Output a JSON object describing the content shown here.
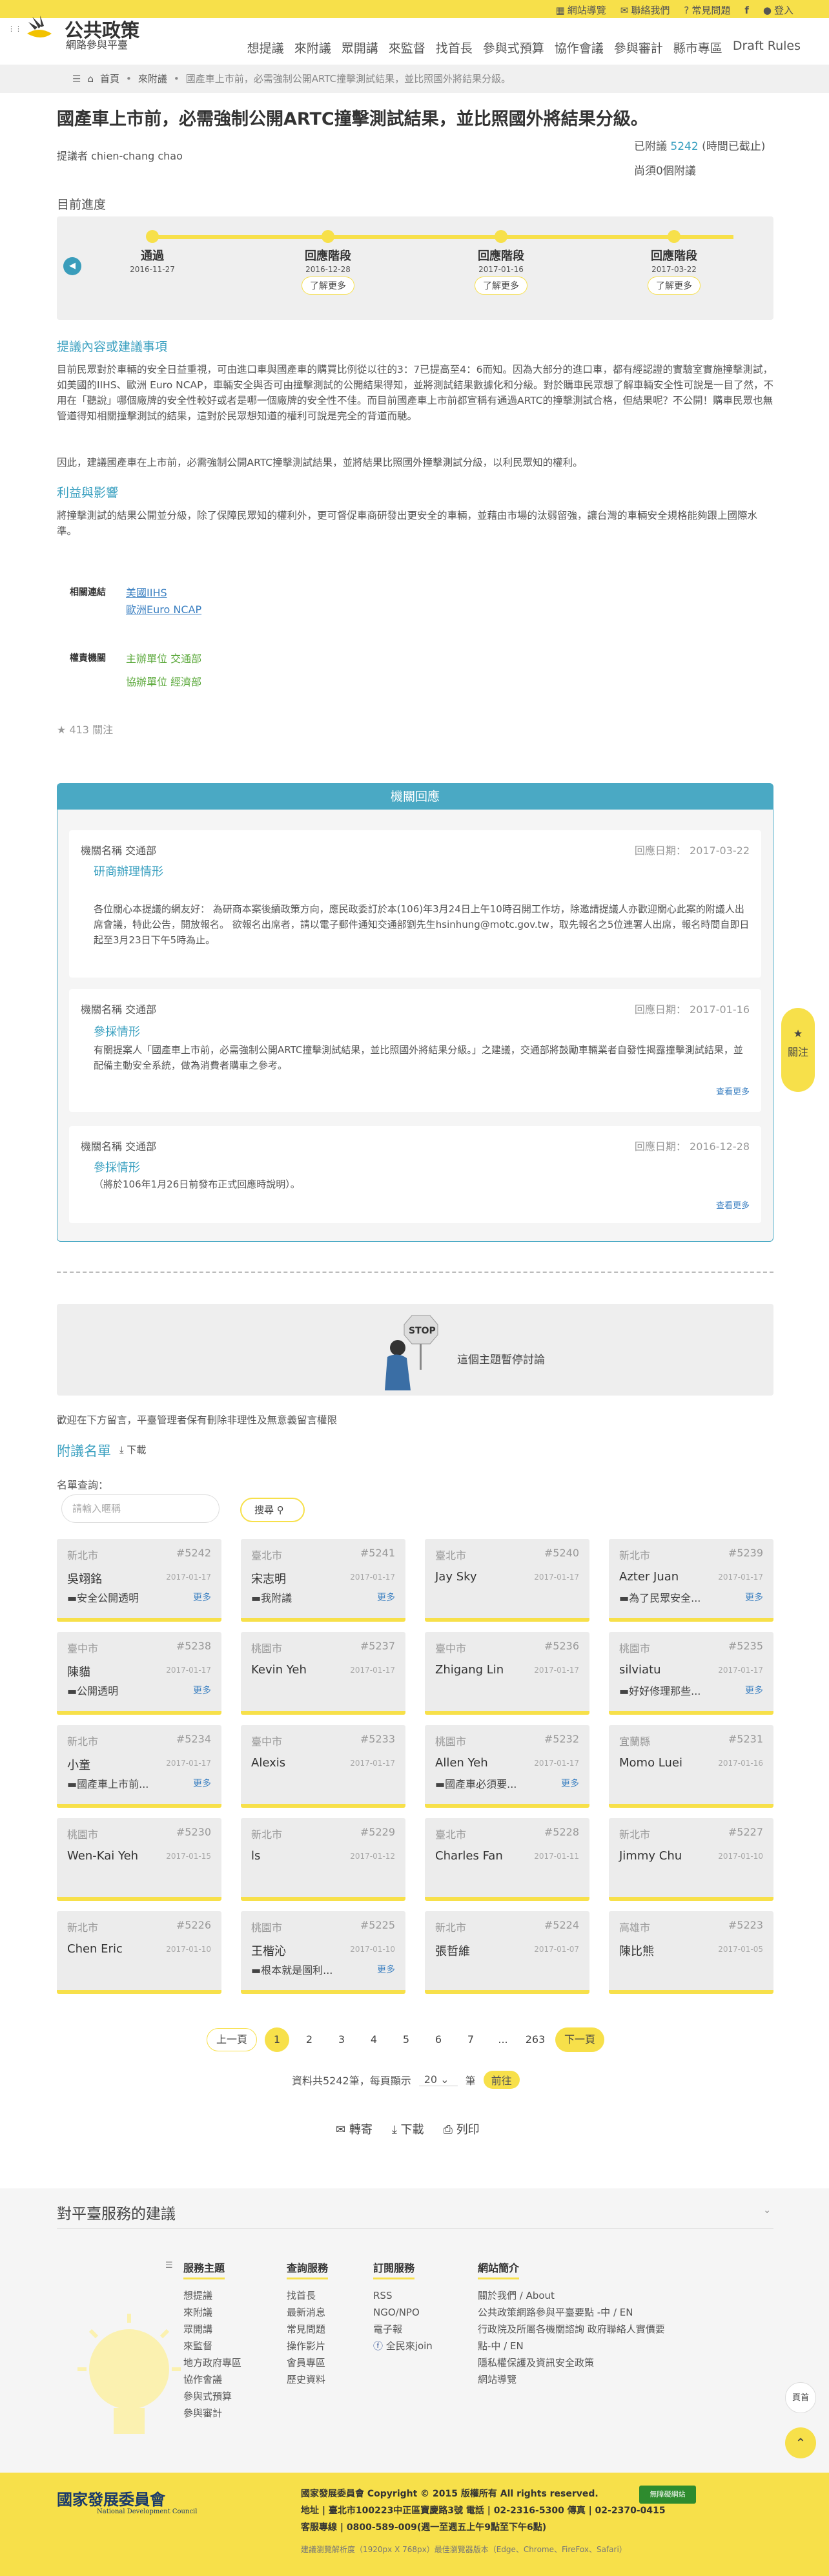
{
  "topbar": {
    "sitemap": "網站導覽",
    "contact": "聯絡我們",
    "faq": "常見問題",
    "login": "登入"
  },
  "logo": {
    "line1": "公共政策",
    "line2": "網路參與平臺"
  },
  "nav": [
    "想提議",
    "來附議",
    "眾開講",
    "來監督",
    "找首長",
    "參與式預算",
    "協作會議",
    "參與審計",
    "縣市專區",
    "Draft Rules"
  ],
  "breadcrumb": [
    "首頁",
    "來附議",
    "國產車上市前，必需強制公開ARTC撞擊測試結果，並比照國外將結果分級。"
  ],
  "proposal": {
    "title": "國產車上市前，必需強制公開ARTC撞擊測試結果，並比照國外將結果分級。",
    "author": "提議者 chien-chang chao",
    "signed_prefix": "已附議",
    "signed_count": "5242",
    "signed_suffix": "(時間已截止)",
    "needed": "尚須0個附議",
    "progress_heading": "目前進度",
    "stages": [
      {
        "name": "通過",
        "date": "2016-11-27",
        "more": ""
      },
      {
        "name": "回應階段",
        "date": "2016-12-28",
        "more": "了解更多"
      },
      {
        "name": "回應階段",
        "date": "2017-01-16",
        "more": "了解更多"
      },
      {
        "name": "回應階段",
        "date": "2017-03-22",
        "more": "了解更多"
      }
    ],
    "content_heading": "提議內容或建議事項",
    "content_p1": "目前民眾對於車輛的安全日益重視，可由進口車與國產車的購買比例從以往的3：7已提高至4：6而知。因為大部分的進口車，都有經認證的實驗室實施撞擊測試，如美國的IIHS、歐洲 Euro NCAP，車輛安全與否可由撞擊測試的公開結果得知，並將測試結果數據化和分級。對於購車民眾想了解車輛安全性可說是一目了然，不用在「聽說」哪個廠牌的安全性較好或者是哪一個廠牌的安全性不佳。而目前國產車上市前都宣稱有通過ARTC的撞擊測試合格，但結果呢？不公開！購車民眾也無管道得知相關撞擊測試的結果，這對於民眾想知道的權利可說是完全的背道而馳。",
    "content_p2": "因此，建議國產車在上市前，必需強制公開ARTC撞擊測試結果，並將結果比照國外撞擊測試分級，以利民眾知的權利。",
    "benefit_heading": "利益與影響",
    "benefit_text": "將撞擊測試的結果公開並分級，除了保障民眾知的權利外，更可督促車商研發出更安全的車輛，並藉由市場的汰弱留強，讓台灣的車輛安全規格能夠跟上國際水準。",
    "links_label": "相關連結",
    "links": [
      "美國IIHS",
      "歐洲Euro NCAP"
    ],
    "orgs_label": "權責機關",
    "orgs": [
      "主辦單位 交通部",
      "協辦單位 經濟部"
    ],
    "follow": "413 關注"
  },
  "responses": {
    "header": "機關回應",
    "items": [
      {
        "org": "機關名稱  交通部",
        "date": "回應日期： 2017-03-22",
        "title": "研商辦理情形",
        "body": "各位關心本提議的網友好： 為研商本案後續政策方向，應民政委訂於本(106)年3月24日上午10時召開工作坊，除邀請提議人亦歡迎關心此案的附議人出席會議，特此公告，開放報名。 欲報名出席者，請以電子郵件通知交通部劉先生hsinhung@motc.gov.tw，取先報名之5位連署人出席，報名時間自即日起至3月23日下午5時為止。",
        "more": ""
      },
      {
        "org": "機關名稱  交通部",
        "date": "回應日期： 2017-01-16",
        "title": "參採情形",
        "body": "有關提案人「國產車上市前，必需強制公開ARTC撞擊測試結果，並比照國外將結果分級。」之建議，交通部將鼓勵車輛業者自發性揭露撞擊測試結果，並配備主動安全系統，做為消費者購車之參考。",
        "more": "查看更多"
      },
      {
        "org": "機關名稱  交通部",
        "date": "回應日期： 2016-12-28",
        "title": "參採情形",
        "body": "（將於106年1月26日前發布正式回應時說明）。",
        "more": "查看更多"
      }
    ]
  },
  "discussion": {
    "paused": "這個主題暫停討論",
    "stop": "STOP"
  },
  "sign": {
    "note": "歡迎在下方留言，平臺管理者保有刪除非理性及無意義留言權限",
    "heading": "附議名單",
    "download": "下載",
    "query_label": "名單查詢：",
    "query_placeholder": "請輸入暱稱",
    "search": "搜尋",
    "cards": [
      {
        "city": "新北市",
        "no": "#5242",
        "name": "吳翊銘",
        "date": "2017-01-17",
        "comment": "安全公開透明",
        "more": "更多"
      },
      {
        "city": "臺北市",
        "no": "#5241",
        "name": "宋志明",
        "date": "2017-01-17",
        "comment": "我附議",
        "more": "更多"
      },
      {
        "city": "臺北市",
        "no": "#5240",
        "name": "Jay Sky",
        "date": "2017-01-17",
        "comment": "",
        "more": ""
      },
      {
        "city": "新北市",
        "no": "#5239",
        "name": "Azter Juan",
        "date": "2017-01-17",
        "comment": "為了民眾安全...",
        "more": "更多"
      },
      {
        "city": "臺中市",
        "no": "#5238",
        "name": "陳貓",
        "date": "2017-01-17",
        "comment": "公開透明",
        "more": "更多"
      },
      {
        "city": "桃園市",
        "no": "#5237",
        "name": "Kevin Yeh",
        "date": "2017-01-17",
        "comment": "",
        "more": ""
      },
      {
        "city": "臺中市",
        "no": "#5236",
        "name": "Zhigang Lin",
        "date": "2017-01-17",
        "comment": "",
        "more": ""
      },
      {
        "city": "桃園市",
        "no": "#5235",
        "name": "silviatu",
        "date": "2017-01-17",
        "comment": "好好修理那些...",
        "more": "更多"
      },
      {
        "city": "新北市",
        "no": "#5234",
        "name": "小童",
        "date": "2017-01-17",
        "comment": "國產車上市前...",
        "more": "更多"
      },
      {
        "city": "臺中市",
        "no": "#5233",
        "name": "Alexis",
        "date": "2017-01-17",
        "comment": "",
        "more": ""
      },
      {
        "city": "桃園市",
        "no": "#5232",
        "name": "Allen Yeh",
        "date": "2017-01-17",
        "comment": "國產車必須要...",
        "more": "更多"
      },
      {
        "city": "宜蘭縣",
        "no": "#5231",
        "name": "Momo Luei",
        "date": "2017-01-16",
        "comment": "",
        "more": ""
      },
      {
        "city": "桃園市",
        "no": "#5230",
        "name": "Wen-Kai Yeh",
        "date": "2017-01-15",
        "comment": "",
        "more": ""
      },
      {
        "city": "新北市",
        "no": "#5229",
        "name": "ls",
        "date": "2017-01-12",
        "comment": "",
        "more": ""
      },
      {
        "city": "臺北市",
        "no": "#5228",
        "name": "Charles Fan",
        "date": "2017-01-11",
        "comment": "",
        "more": ""
      },
      {
        "city": "新北市",
        "no": "#5227",
        "name": "Jimmy Chu",
        "date": "2017-01-10",
        "comment": "",
        "more": ""
      },
      {
        "city": "新北市",
        "no": "#5226",
        "name": "Chen Eric",
        "date": "2017-01-10",
        "comment": "",
        "more": ""
      },
      {
        "city": "桃園市",
        "no": "#5225",
        "name": "王楷沁",
        "date": "2017-01-10",
        "comment": "根本就是圖利...",
        "more": "更多"
      },
      {
        "city": "新北市",
        "no": "#5224",
        "name": "張哲維",
        "date": "2017-01-07",
        "comment": "",
        "more": ""
      },
      {
        "city": "高雄市",
        "no": "#5223",
        "name": "陳比熊",
        "date": "2017-01-05",
        "comment": "",
        "more": ""
      }
    ]
  },
  "pager": {
    "prev": "上一頁",
    "pages": [
      "1",
      "2",
      "3",
      "4",
      "5",
      "6",
      "7",
      "...",
      "263"
    ],
    "next": "下一頁",
    "total": "資料共5242筆，每頁顯示",
    "per": "20",
    "unit": "筆",
    "go": "前往"
  },
  "actions": {
    "mail": "轉寄",
    "download": "下載",
    "print": "列印"
  },
  "side": {
    "follow": "關注",
    "top_mark": "頁首"
  },
  "footer": {
    "heading": "對平臺服務的建議",
    "cols": [
      {
        "title": "服務主題",
        "items": [
          "想提議",
          "來附議",
          "眾開講",
          "來監督",
          "地方政府專區",
          "協作會議",
          "參與式預算",
          "參與審計"
        ]
      },
      {
        "title": "查詢服務",
        "items": [
          "找首長",
          "最新消息",
          "常見問題",
          "操作影片",
          "會員專區",
          "歷史資料"
        ]
      },
      {
        "title": "訂閱服務",
        "items": [
          "RSS",
          "NGO/NPO",
          "電子報",
          "全民來join"
        ]
      },
      {
        "title": "網站簡介",
        "items": [
          "關於我們 / About",
          "公共政策網路參與平臺要點 -中 / EN",
          "行政院及所屬各機關諮詢 政府聯絡人實價要點-中 / EN",
          "隱私權保護及資訊安全政策",
          "網站導覽"
        ]
      }
    ],
    "ndc": "國家發展委員會",
    "ndc_en": "National Development Council",
    "copy": "國家發展委員會 Copyright © 2015 版權所有 All rights reserved.",
    "addr": "地址 | 臺北市100223中正區寶慶路3號 電話 | 02-2316-5300 傳真 | 02-2370-0415",
    "hours": "客服專線 | 0800-589-009(週一至週五上午9點至下午6點)",
    "browser": "建議瀏覽解析度（1920px X 768px）最佳瀏覽器版本（Edge、Chrome、FireFox、Safari）",
    "badge": "無障礙網站"
  }
}
